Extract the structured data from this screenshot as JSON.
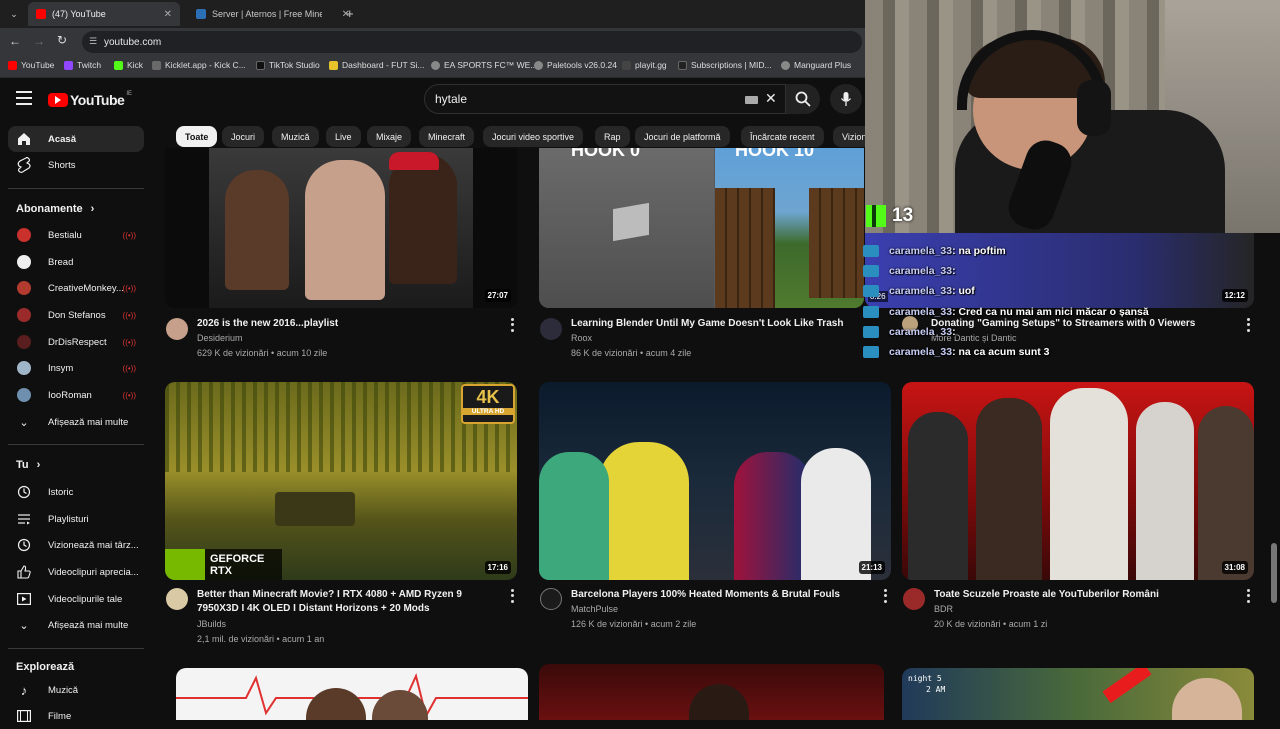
{
  "browser": {
    "tabs": [
      {
        "title": "(47) YouTube",
        "active": true
      },
      {
        "title": "Server | Aternos | Free Minecraft",
        "active": false
      }
    ],
    "url": "youtube.com",
    "bookmarks": [
      "YouTube",
      "Twitch",
      "Kick",
      "Kicklet.app - Kick C...",
      "TikTok Studio",
      "Dashboard - FUT Si...",
      "EA SPORTS FC™ WE...",
      "Paletools v26.0.24",
      "playit.gg",
      "Subscriptions | MID...",
      "Manguard Plus"
    ]
  },
  "masthead": {
    "logo": "YouTube",
    "country": "IE",
    "search_value": "hytale"
  },
  "sidebar": {
    "home": "Acasă",
    "shorts": "Shorts",
    "subscriptions_title": "Abonamente",
    "subscriptions": [
      {
        "name": "Bestialu",
        "color": "#c9312c"
      },
      {
        "name": "Bread",
        "color": "#2a5db0"
      },
      {
        "name": "CreativeMonkey...",
        "color": "#b23a2e"
      },
      {
        "name": "Don Stefanos",
        "color": "#9b2b2b"
      },
      {
        "name": "DrDisRespect",
        "color": "#5a1e1e"
      },
      {
        "name": "Insym",
        "color": "#9fb5c9"
      },
      {
        "name": "IooRoman",
        "color": "#6e8fae"
      }
    ],
    "show_more": "Afișează mai multe",
    "you_title": "Tu",
    "you_items": [
      "Istoric",
      "Playlisturi",
      "Vizionează mai târz...",
      "Videoclipuri aprecia...",
      "Videoclipurile tale"
    ],
    "show_more_2": "Afișează mai multe",
    "explore_title": "Explorează",
    "explore_items": [
      "Muzică",
      "Filme"
    ]
  },
  "chips": [
    "Toate",
    "Jocuri",
    "Muzică",
    "Live",
    "Mixaje",
    "Minecraft",
    "Jocuri video sportive",
    "Rap",
    "Jocuri de platformă",
    "Încărcate recent",
    "Vizion"
  ],
  "videos_row1": [
    {
      "title": "2026 is the new 2016...playlist",
      "channel": "Desiderium",
      "meta": "629 K de vizionări • acum 10 zile",
      "duration": "27:07"
    },
    {
      "title": "Learning Blender Until My Game Doesn't Look Like Trash",
      "channel": "Roox",
      "meta": "86 K de vizionări • acum 4 zile",
      "duration": ""
    },
    {
      "title": "Donating \"Gaming Setups\" to Streamers with 0 Viewers",
      "channel": "More Dantic și Dantic",
      "meta": "",
      "duration": "12:12",
      "partial_duration": "8:26"
    }
  ],
  "videos_row2": [
    {
      "title": "Better than Minecraft Movie? I RTX 4080 + AMD Ryzen 9 7950X3D I 4K OLED I Distant Horizons + 20 Mods",
      "channel": "JBuilds",
      "meta": "2,1 mil. de vizionări • acum 1 an",
      "duration": "17:16",
      "badge_4k": "4K",
      "badge_uhd": "ULTRA HD",
      "badge_nvidia": "GEFORCE RTX"
    },
    {
      "title": "Barcelona Players 100% Heated Moments & Brutal Fouls",
      "channel": "MatchPulse",
      "meta": "126 K de vizionări • acum 2 zile",
      "duration": "21:13"
    },
    {
      "title": "Toate Scuzele Proaste ale YouTuberilor Români",
      "channel": "BDR",
      "meta": "20 K de vizionări • acum 1 zi",
      "duration": "31:08"
    }
  ],
  "row1_thumb_text": [
    "HOOK 0",
    "HOOK 10"
  ],
  "row3_thumb_text": [
    "night 5",
    "2 AM"
  ],
  "stream_overlay": {
    "kick_viewers": "13",
    "chat": [
      {
        "user": "caramela_33",
        "text": ": na poftim"
      },
      {
        "user": "caramela_33",
        "text": ":"
      },
      {
        "user": "caramela_33",
        "text": ": uof"
      },
      {
        "user": "caramela_33",
        "text": ": Cred ca nu mai am nici măcar o șansă"
      },
      {
        "user": "caramela_33",
        "text": ":"
      },
      {
        "user": "caramela_33",
        "text": ": na ca acum sunt 3"
      }
    ]
  },
  "colors": {
    "bg": "#0f0f0f",
    "chip": "#272727",
    "youtube_red": "#ff0000",
    "kick_green": "#53fc18"
  }
}
